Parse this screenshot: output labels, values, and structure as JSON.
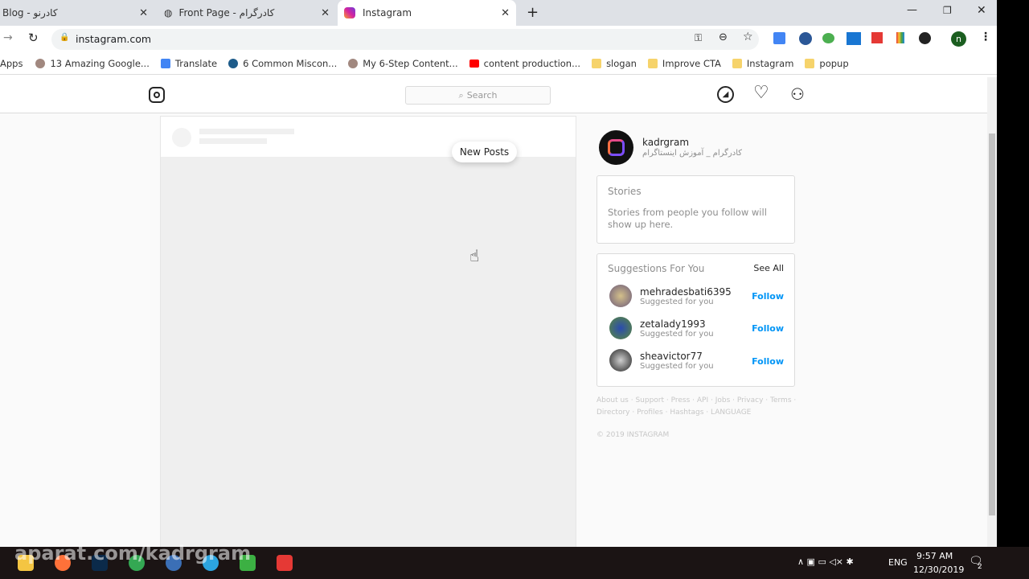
{
  "browser": {
    "tabs": [
      {
        "label": "Blog - کادرنو"
      },
      {
        "label": "Front Page - کادرگرام"
      },
      {
        "label": "Instagram"
      }
    ],
    "url": "instagram.com",
    "bookmarks": [
      "Apps",
      "13 Amazing Google...",
      "Translate",
      "6 Common Miscon...",
      "My 6-Step Content...",
      "content production...",
      "slogan",
      "Improve CTA",
      "Instagram",
      "popup"
    ],
    "profile_initial": "n"
  },
  "instagram": {
    "search_placeholder": "Search",
    "new_posts": "New Posts",
    "user": {
      "username": "kadrgram",
      "full_name": "کادرگرام _ آموزش اینستاگرام"
    },
    "stories": {
      "title": "Stories",
      "empty": "Stories from people you follow will show up here."
    },
    "suggestions": {
      "title": "Suggestions For You",
      "see_all": "See All",
      "items": [
        {
          "username": "mehradesbati6395",
          "sub": "Suggested for you",
          "action": "Follow"
        },
        {
          "username": "zetalady1993",
          "sub": "Suggested for you",
          "action": "Follow"
        },
        {
          "username": "sheavictor77",
          "sub": "Suggested for you",
          "action": "Follow"
        }
      ]
    },
    "footer_links": "About us · Support · Press · API · Jobs · Privacy · Terms ·",
    "footer_links2": "Directory · Profiles · Hashtags · LANGUAGE",
    "copyright": "© 2019 INSTAGRAM",
    "accent": "#0095f6"
  },
  "watermark": "aparat.com/kadrgram",
  "taskbar": {
    "lang": "ENG",
    "time": "9:57 AM",
    "date": "12/30/2019",
    "notifications": "2"
  }
}
